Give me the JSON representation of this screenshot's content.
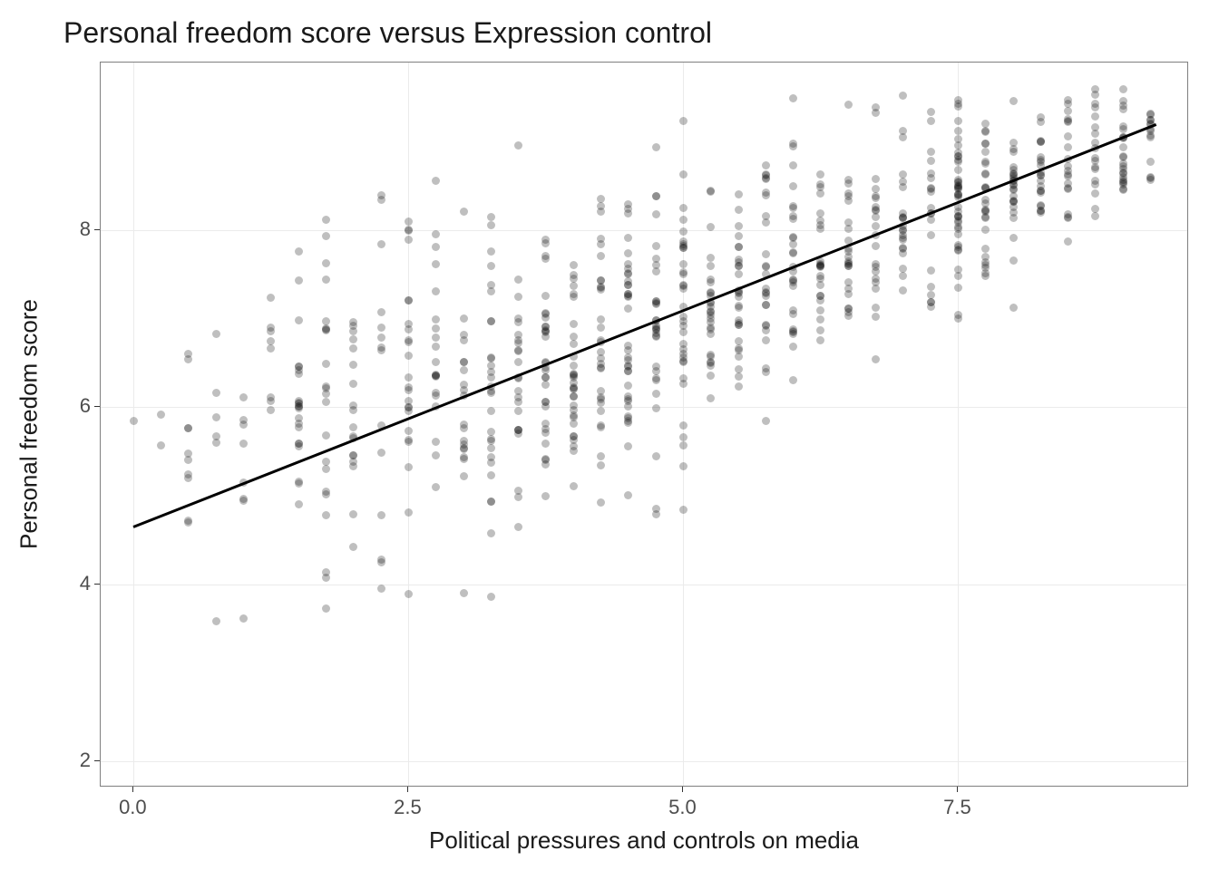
{
  "chart_data": {
    "type": "scatter",
    "title": "Personal freedom score versus Expression control",
    "xlabel": "Political pressures and controls on media",
    "ylabel": "Personal freedom score",
    "xlim": [
      -0.3,
      9.6
    ],
    "ylim": [
      1.7,
      9.9
    ],
    "xticks": [
      0.0,
      2.5,
      5.0,
      7.5
    ],
    "yticks": [
      2,
      4,
      6,
      8
    ],
    "xtick_labels": [
      "0.0",
      "2.5",
      "5.0",
      "7.5"
    ],
    "ytick_labels": [
      "2",
      "4",
      "6",
      "8"
    ],
    "regression": {
      "x1": 0.0,
      "y1": 4.65,
      "x2": 9.3,
      "y2": 9.2
    },
    "x_levels": [
      0.0,
      0.25,
      0.5,
      0.75,
      1.0,
      1.25,
      1.5,
      1.75,
      2.0,
      2.25,
      2.5,
      2.75,
      3.0,
      3.25,
      3.5,
      3.75,
      4.0,
      4.25,
      4.5,
      4.75,
      5.0,
      5.25,
      5.5,
      5.75,
      6.0,
      6.25,
      6.5,
      6.75,
      7.0,
      7.25,
      7.5,
      7.75,
      8.0,
      8.25,
      8.5,
      8.75,
      9.0,
      9.25
    ],
    "n_per_level": [
      1,
      2,
      10,
      6,
      8,
      8,
      22,
      22,
      18,
      14,
      24,
      20,
      20,
      28,
      24,
      32,
      32,
      30,
      36,
      30,
      34,
      28,
      28,
      26,
      28,
      24,
      24,
      22,
      22,
      20,
      44,
      28,
      26,
      22,
      20,
      18,
      24,
      14
    ],
    "sd_per_level": [
      0.0,
      0.3,
      1.2,
      1.1,
      1.0,
      0.6,
      1.0,
      1.1,
      1.0,
      1.2,
      1.0,
      0.9,
      1.0,
      1.2,
      0.9,
      0.9,
      0.8,
      0.8,
      0.8,
      0.8,
      0.9,
      0.7,
      0.7,
      0.7,
      0.7,
      0.65,
      0.6,
      0.6,
      0.55,
      0.55,
      0.6,
      0.55,
      0.5,
      0.5,
      0.5,
      0.45,
      0.4,
      0.35
    ],
    "mean_offset_per_level": [
      1.2,
      1.0,
      0.3,
      0.2,
      0.1,
      0.8,
      0.5,
      0.4,
      0.3,
      0.0,
      0.1,
      0.4,
      0.1,
      0.0,
      0.0,
      0.1,
      -0.1,
      -0.1,
      -0.1,
      -0.1,
      -0.2,
      -0.1,
      0.0,
      0.0,
      0.0,
      0.0,
      0.0,
      0.0,
      0.0,
      0.0,
      0.0,
      0.0,
      0.0,
      0.0,
      0.0,
      0.0,
      0.0,
      0.0
    ]
  }
}
